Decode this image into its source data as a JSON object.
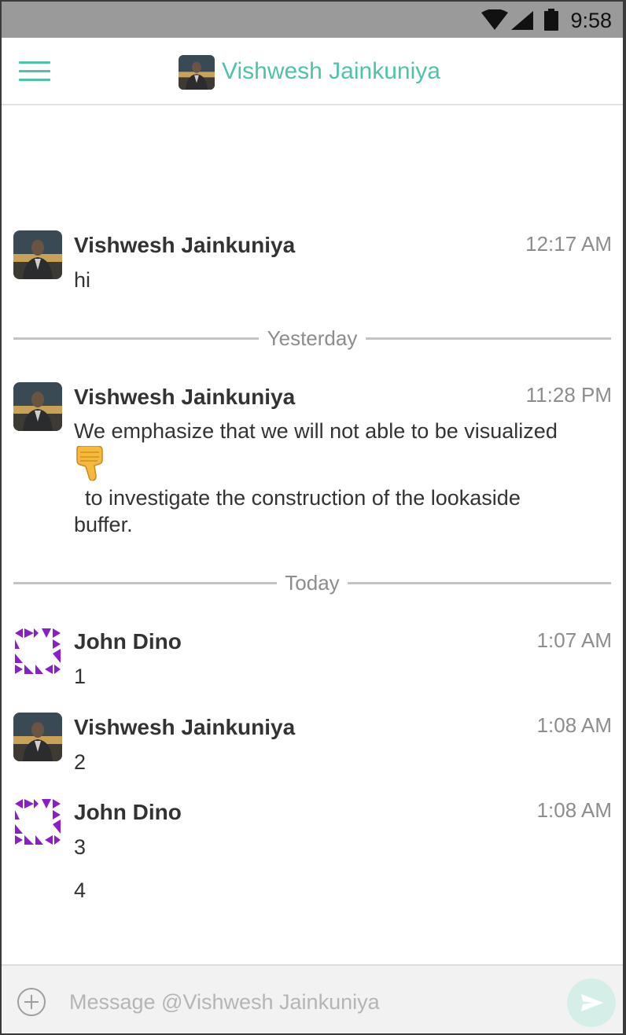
{
  "status_bar": {
    "time": "9:58",
    "icons": [
      "wifi-icon",
      "cellular-signal-icon",
      "battery-icon"
    ]
  },
  "header": {
    "title": "Vishwesh Jainkuniya",
    "menu_icon": "hamburger-menu-icon",
    "accent_color": "#4fc3a9"
  },
  "messages": [
    {
      "sender": "Vishwesh Jainkuniya",
      "time": "12:17 AM",
      "text": "hi",
      "avatar": "photo"
    },
    {
      "divider": "Yesterday"
    },
    {
      "sender": "Vishwesh Jainkuniya",
      "time": "11:28 PM",
      "text_line1": "We emphasize that we will not able to be visualized",
      "emoji": "thumbs-down-emoji",
      "text_line2": "to investigate the construction of the lookaside",
      "text_line3": "buffer.",
      "avatar": "photo"
    },
    {
      "divider": "Today"
    },
    {
      "sender": "John Dino",
      "time": "1:07 AM",
      "text": "1",
      "avatar": "identicon"
    },
    {
      "sender": "Vishwesh Jainkuniya",
      "time": "1:08 AM",
      "text": "2",
      "avatar": "photo"
    },
    {
      "sender": "John Dino",
      "time": "1:08 AM",
      "text": "3",
      "text_extra": "4",
      "avatar": "identicon"
    }
  ],
  "composer": {
    "placeholder": "Message @Vishwesh Jainkuniya",
    "value": "",
    "plus_icon": "add-circle-icon",
    "send_icon": "send-icon"
  },
  "colors": {
    "identicon": "#8a1fc9",
    "status_bar": "#9a9a9a",
    "send_button": "#d5efe8"
  }
}
